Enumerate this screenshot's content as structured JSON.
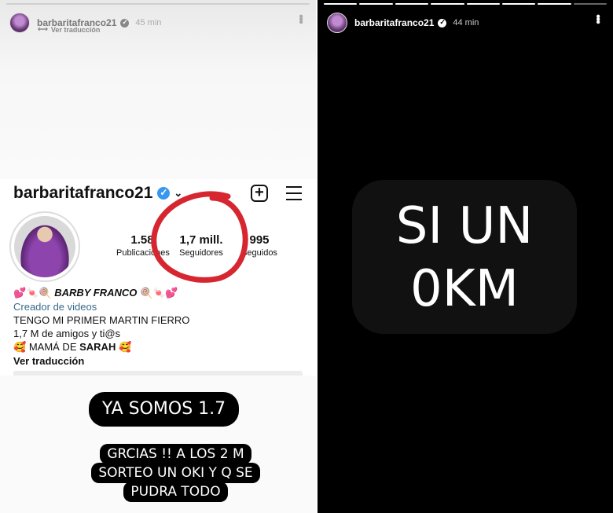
{
  "left_story": {
    "username": "barbaritafranco21",
    "time": "45 min",
    "translate": "Ver traducción",
    "profile": {
      "handle": "barbaritafranco21",
      "stats": [
        {
          "value": "1.58",
          "label": "Publicaciones"
        },
        {
          "value": "1,7 mill.",
          "label": "Seguidores"
        },
        {
          "value": "995",
          "label": "Seguidos"
        }
      ],
      "bio": {
        "name_line": "BARBY FRANCO",
        "category": "Creador de videos",
        "line1": "TENGO MI PRIMER MARTIN FIERRO",
        "line2": "1,7 M de amigos y ti@s",
        "line3_prefix": "MAMÁ DE ",
        "line3_name": "SARAH",
        "translate": "Ver traducción"
      }
    },
    "caption_1": "YA SOMOS 1.7",
    "caption_2": [
      "GRCIAS !! A LOS 2 M",
      "SORTEO UN OKI Y Q SE",
      "PUDRA TODO"
    ]
  },
  "right_story": {
    "username": "barbaritafranco21",
    "time": "44 min",
    "text_lines": [
      "SI UN",
      "0KM"
    ]
  },
  "colors": {
    "verified_blue": "#3897f0",
    "marker_red": "#d6262f",
    "creator_link": "#3a6a8a"
  },
  "icons": {
    "verified": "verified-badge-icon",
    "more": "more-vertical-icon",
    "new_post": "plus-square-icon",
    "menu": "hamburger-menu-icon",
    "dropdown": "chevron-down-icon"
  }
}
